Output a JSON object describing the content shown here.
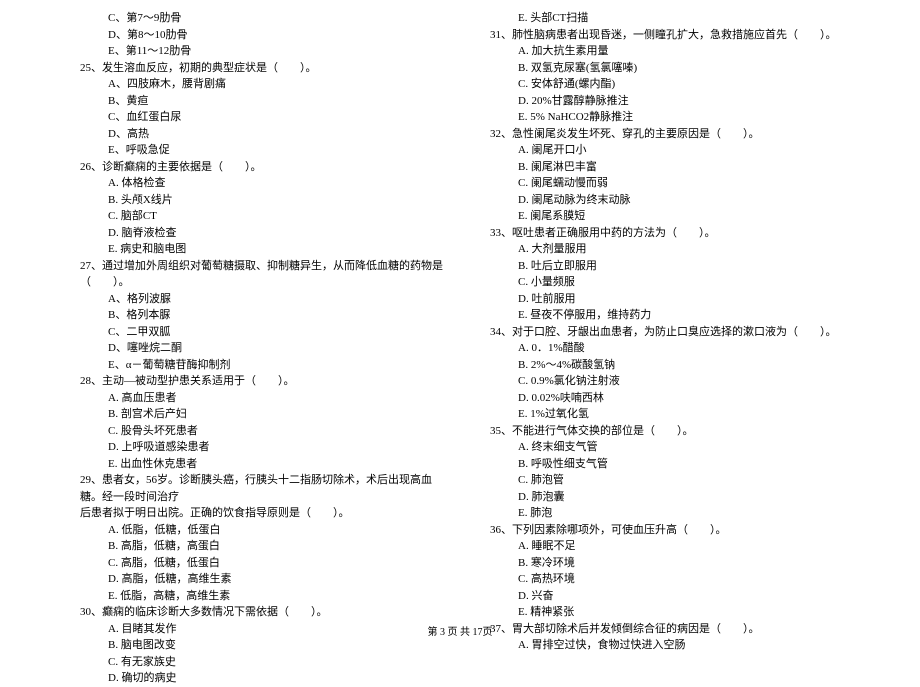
{
  "left": {
    "pre_options": [
      "C、第7～9肋骨",
      "D、第8～10肋骨",
      "E、第11～12肋骨"
    ],
    "questions": [
      {
        "stem": "25、发生溶血反应，初期的典型症状是（　　）。",
        "options": [
          "A、四肢麻木，腰背剧痛",
          "B、黄疸",
          "C、血红蛋白尿",
          "D、高热",
          "E、呼吸急促"
        ]
      },
      {
        "stem": "26、诊断癫痫的主要依据是（　　）。",
        "options": [
          "A. 体格检查",
          "B. 头颅X线片",
          "C. 脑部CT",
          "D. 脑脊液检查",
          "E. 病史和脑电图"
        ]
      },
      {
        "stem": "27、通过增加外周组织对葡萄糖摄取、抑制糖异生，从而降低血糖的药物是（　　）。",
        "options": [
          "A、格列波脲",
          "B、格列本脲",
          "C、二甲双胍",
          "D、噻唑烷二酮",
          "E、α－葡萄糖苷酶抑制剂"
        ]
      },
      {
        "stem": "28、主动—被动型护患关系适用于（　　）。",
        "options": [
          "A. 高血压患者",
          "B. 剖宫术后产妇",
          "C. 股骨头坏死患者",
          "D. 上呼吸道感染患者",
          "E. 出血性休克患者"
        ]
      },
      {
        "stem_lines": [
          "29、患者女，56岁。诊断胰头癌，行胰头十二指肠切除术，术后出现高血糖。经一段时间治疗",
          "后患者拟于明日出院。正确的饮食指导原则是（　　）。"
        ],
        "options": [
          "A. 低脂，低糖，低蛋白",
          "B. 高脂，低糖，高蛋白",
          "C. 高脂，低糖，低蛋白",
          "D. 高脂，低糖，高维生素",
          "E. 低脂，高糖，高维生素"
        ]
      },
      {
        "stem": "30、癫痫的临床诊断大多数情况下需依据（　　）。",
        "options": [
          "A. 目睹其发作",
          "B. 脑电图改变",
          "C. 有无家族史",
          "D. 确切的病史"
        ]
      }
    ]
  },
  "right": {
    "pre_options": [
      "E. 头部CT扫描"
    ],
    "questions": [
      {
        "stem": "31、肺性脑病患者出现昏迷，一侧瞳孔扩大，急救措施应首先（　　）。",
        "options": [
          "A. 加大抗生素用量",
          "B. 双氢克尿塞(氢氯噻嗪)",
          "C. 安体舒通(螺内酯)",
          "D. 20%甘露醇静脉推注",
          "E. 5% NaHCO2静脉推注"
        ]
      },
      {
        "stem": "32、急性阑尾炎发生坏死、穿孔的主要原因是（　　）。",
        "options": [
          "A. 阑尾开口小",
          "B. 阑尾淋巴丰富",
          "C. 阑尾蠕动慢而弱",
          "D. 阑尾动脉为终末动脉",
          "E. 阑尾系膜短"
        ]
      },
      {
        "stem": "33、呕吐患者正确服用中药的方法为（　　）。",
        "options": [
          "A. 大剂量服用",
          "B. 吐后立即服用",
          "C. 小量频服",
          "D. 吐前服用",
          "E. 昼夜不停服用，维持药力"
        ]
      },
      {
        "stem": "34、对于口腔、牙龈出血患者，为防止口臭应选择的漱口液为（　　）。",
        "options": [
          "A. 0．1%醋酸",
          "B. 2%～4%碳酸氢钠",
          "C. 0.9%氯化钠注射液",
          "D. 0.02%呋喃西林",
          "E. 1%过氧化氢"
        ]
      },
      {
        "stem": "35、不能进行气体交换的部位是（　　）。",
        "options": [
          "A. 终末细支气管",
          "B. 呼吸性细支气管",
          "C. 肺泡管",
          "D. 肺泡囊",
          "E. 肺泡"
        ]
      },
      {
        "stem": "36、下列因素除哪项外，可使血压升高（　　）。",
        "options": [
          "A. 睡眠不足",
          "B. 寒冷环境",
          "C. 高热环境",
          "D. 兴奋",
          "E. 精神紧张"
        ]
      },
      {
        "stem": "37、胃大部切除术后并发倾倒综合征的病因是（　　）。",
        "options": [
          "A. 胃排空过快，食物过快进入空肠"
        ]
      }
    ]
  },
  "footer": "第 3 页 共 17页"
}
